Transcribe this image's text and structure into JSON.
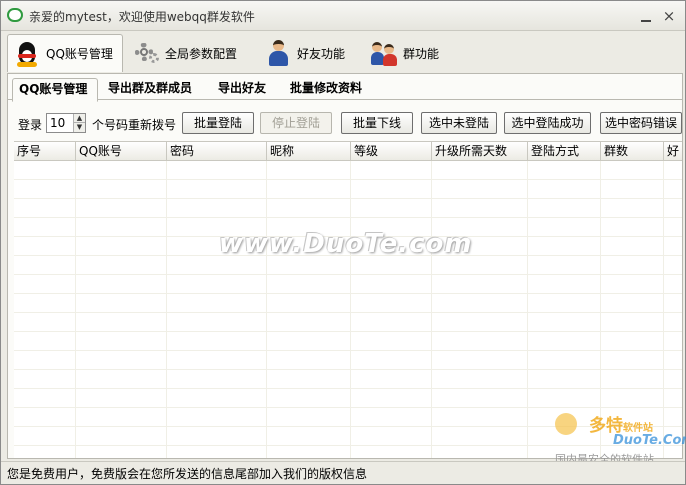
{
  "window": {
    "title": "亲爱的mytest，欢迎使用webqq群发软件",
    "minimize": "",
    "close": "×"
  },
  "main_tabs": [
    {
      "label": "QQ账号管理",
      "icon": "penguin-icon",
      "active": true
    },
    {
      "label": "全局参数配置",
      "icon": "gear-icon",
      "active": false
    },
    {
      "label": "好友功能",
      "icon": "friend-icon",
      "active": false
    },
    {
      "label": "群功能",
      "icon": "group-icon",
      "active": false
    }
  ],
  "sub_tabs": [
    {
      "label": "QQ账号管理",
      "active": true
    },
    {
      "label": "导出群及群成员",
      "active": false
    },
    {
      "label": "导出好友",
      "active": false
    },
    {
      "label": "批量修改资料",
      "active": false
    }
  ],
  "controls": {
    "login_label": "登录",
    "redial_count": "10",
    "redial_suffix": "个号码重新拨号",
    "buttons": [
      {
        "label": "批量登陆",
        "disabled": false
      },
      {
        "label": "停止登陆",
        "disabled": true
      },
      {
        "label": "批量下线",
        "disabled": false
      },
      {
        "label": "选中未登陆",
        "disabled": false
      },
      {
        "label": "选中登陆成功",
        "disabled": false
      },
      {
        "label": "选中密码错误",
        "disabled": false
      }
    ]
  },
  "table": {
    "columns": [
      "序号",
      "QQ账号",
      "密码",
      "昵称",
      "等级",
      "升级所需天数",
      "登陆方式",
      "群数",
      "好"
    ],
    "rows": []
  },
  "watermark": "www.DuoTe.com",
  "corner_logo": {
    "line1": "多特",
    "line1_small": "软件站",
    "line2": "DuoTe.Com",
    "line3": "国内最安全的软件站"
  },
  "status": {
    "text": "您是免费用户，免费版会在您所发送的信息尾部加入我们的版权信息"
  }
}
